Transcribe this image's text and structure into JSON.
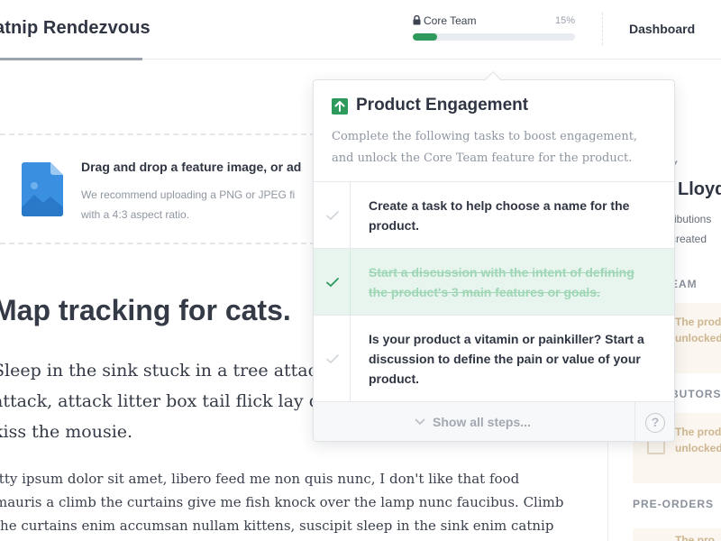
{
  "header": {
    "product_name": "atnip Rendezvous",
    "progress_label": "Core Team",
    "progress_percent_text": "15%",
    "progress_fraction": 0.15,
    "dashboard_label": "Dashboard"
  },
  "upload": {
    "title": "Drag and drop a feature image, or ad",
    "desc_lines": [
      "We recommend uploading a PNG or JPEG fi",
      "with a 4:3 aspect ratio."
    ]
  },
  "article": {
    "headline": "Map tracking for cats.",
    "lead_lines": [
      "Sleep in the sink stuck in a tree attack",
      "attack, attack litter box tail flick lay do",
      "kiss the mousie."
    ],
    "body_lines": [
      "itty ipsum dolor sit amet, libero feed me non quis nunc, I don't like that food",
      "mauris a climb the curtains give me fish knock over the lamp nunc faucibus. Climb",
      "the curtains enim accumsan nullam kittens, suscipit sleep in the sink enim catnip"
    ]
  },
  "sidebar": {
    "owner_caps": "Y",
    "owner_name": "Lloyd",
    "owner_lines": [
      "ributions",
      "created"
    ],
    "team_caps": "EAM",
    "contributors_caps": "BUTORS",
    "preorders_caps": "PRE-ORDERS",
    "locked_lines": [
      "The prod",
      "unlocked"
    ],
    "locked_bottom_text": "The pro"
  },
  "popover": {
    "title": "Product Engagement",
    "desc_lines": [
      "Complete the following tasks to boost engagement,",
      "and unlock the Core Team feature for the product."
    ],
    "tasks": [
      {
        "lines": [
          "Create a task to help choose a name for the",
          "product."
        ],
        "done": false
      },
      {
        "lines": [
          "Start a discussion with the intent of defining",
          "the product's 3 main features or goals."
        ],
        "done": true
      },
      {
        "lines": [
          "Is your product a vitamin or painkiller? Start a",
          "discussion to define the pain or value of your",
          "product."
        ],
        "done": false
      }
    ],
    "show_all_label": "Show all steps...",
    "help_glyph": "?"
  },
  "colors": {
    "accent_green": "#2e9a5c",
    "done_bg": "#e8f5ee",
    "locked_bg": "#fbf6ef"
  },
  "icons": [
    "lock-icon",
    "image-file-icon",
    "arrow-up-icon",
    "check-icon",
    "chevron-down-icon",
    "help-icon"
  ]
}
